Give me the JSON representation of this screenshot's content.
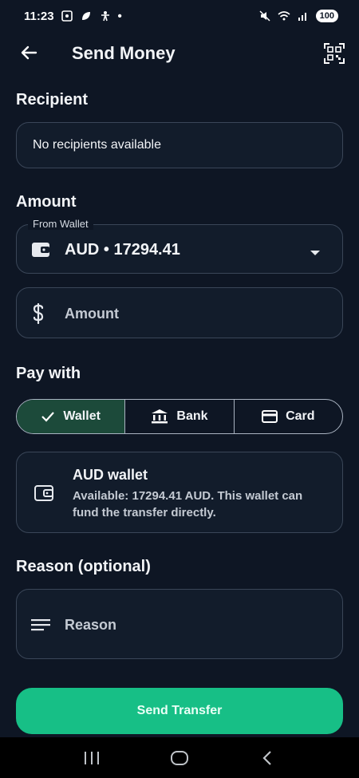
{
  "status_bar": {
    "time": "11:23",
    "dot": "•",
    "battery": "100",
    "icons": [
      "screenshot-icon",
      "leaf-icon",
      "accessibility-icon",
      "mute-icon",
      "wifi-icon",
      "signal-icon"
    ]
  },
  "header": {
    "title": "Send Money",
    "back_icon": "arrow-left-icon",
    "qr_icon": "qr-scanner-icon"
  },
  "recipient": {
    "label": "Recipient",
    "value": "No recipients available"
  },
  "amount": {
    "label": "Amount",
    "wallet_field_label": "From Wallet",
    "wallet_value": "AUD • 17294.41",
    "amount_placeholder": "Amount"
  },
  "pay_with": {
    "label": "Pay with",
    "options": [
      {
        "label": "Wallet",
        "icon": "check-icon",
        "selected": true
      },
      {
        "label": "Bank",
        "icon": "bank-icon",
        "selected": false
      },
      {
        "label": "Card",
        "icon": "card-icon",
        "selected": false
      }
    ]
  },
  "wallet_info": {
    "title": "AUD wallet",
    "description": "Available: 17294.41 AUD. This wallet can fund the transfer directly."
  },
  "reason": {
    "label": "Reason (optional)",
    "placeholder": "Reason"
  },
  "actions": {
    "send_label": "Send Transfer"
  },
  "colors": {
    "background": "#0e1624",
    "accent": "#17bf86",
    "selected_segment": "#1c4a3a",
    "border": "#3a4658"
  }
}
